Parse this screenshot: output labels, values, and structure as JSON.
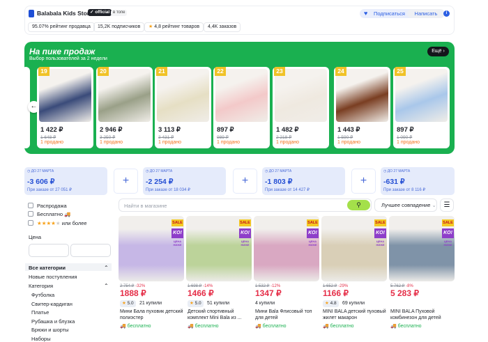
{
  "store": {
    "name": "Balabala Kids Store",
    "official_badge": "official",
    "top_badge": "в топе",
    "rating_seller": "95.07% рейтинг продавца",
    "subscribers": "15,2K подписчиков",
    "rating_goods": "4,8 рейтинг товаров",
    "orders": "4,4K заказов",
    "subscribe_label": "Подписаться",
    "write_label": "Написать"
  },
  "banner": {
    "title": "На пике продаж",
    "subtitle": "Выбор пользователей за 2 недели",
    "more_label": "Ещё",
    "items": [
      {
        "rank": "19",
        "price": "1 422 ₽",
        "old": "1 648 ₽",
        "sold": "1 продано",
        "color": "#3a4b7a"
      },
      {
        "rank": "20",
        "price": "2 946 ₽",
        "old": "3 250 ₽",
        "sold": "1 продано",
        "color": "#9aa088"
      },
      {
        "rank": "21",
        "price": "3 113 ₽",
        "old": "3 431 ₽",
        "sold": "1 продано",
        "color": "#e6dfc4"
      },
      {
        "rank": "22",
        "price": "897 ₽",
        "old": "989 ₽",
        "sold": "1 продано",
        "color": "#f3c9c9"
      },
      {
        "rank": "23",
        "price": "1 482 ₽",
        "old": "2 218 ₽",
        "sold": "1 продано",
        "color": "#efe9e0"
      },
      {
        "rank": "24",
        "price": "1 443 ₽",
        "old": "1 590 ₽",
        "sold": "1 продано",
        "color": "#7a3e22"
      },
      {
        "rank": "25",
        "price": "897 ₽",
        "old": "1 090 ₽",
        "sold": "1 продано",
        "color": "#a9c7ea"
      }
    ]
  },
  "coupons": [
    {
      "date": "ДО 27 МАРТА",
      "amount": "-3 606 ₽",
      "cond": "При заказе от 27 051 ₽"
    },
    {
      "date": "ДО 27 МАРТА",
      "amount": "-2 254 ₽",
      "cond": "При заказе от 18 034 ₽"
    },
    {
      "date": "ДО 27 МАРТА",
      "amount": "-1 803 ₽",
      "cond": "При заказе от 14 427 ₽"
    },
    {
      "date": "ДО 27 МАРТА",
      "amount": "-631 ₽",
      "cond": "При заказе от 8 116 ₽"
    }
  ],
  "filters": {
    "sale": "Распродажа",
    "free": "Бесплатно",
    "rating_suffix": "или более",
    "price_label": "Цена",
    "all_categories": "Все категории",
    "new_arrivals": "Новые поступления",
    "category": "Категория",
    "subcategories": [
      "Футболка",
      "Свитер-кардиган",
      "Платье",
      "Рубашка и блузка",
      "Брюки и шорты",
      "Наборы"
    ]
  },
  "search": {
    "placeholder": "Найти в магазине",
    "sort_label": "Лучшее совпадение"
  },
  "products": [
    {
      "old": "2 754 ₽",
      "disc": "-32%",
      "price": "1888 ₽",
      "rating": "5.0",
      "bought": "21 купили",
      "name": "Мини Бала пуховик детский полиэстер",
      "free": "бесплатно",
      "color": "#c6b7e6"
    },
    {
      "old": "1 698 ₽",
      "disc": "-14%",
      "price": "1466 ₽",
      "rating": "5.0",
      "bought": "51 купили",
      "name": "Детский спортивный комплект Mini Bala из ...",
      "free": "бесплатно",
      "color": "#bcd39a"
    },
    {
      "old": "1 532 ₽",
      "disc": "-12%",
      "price": "1347 ₽",
      "rating": "",
      "bought": "4 купили",
      "name": "Мини Bala Флисовый топ для детей",
      "free": "бесплатно",
      "color": "#d9a8c2"
    },
    {
      "old": "1 652 ₽",
      "disc": "-29%",
      "price": "1166 ₽",
      "rating": "4.8",
      "bought": "69 купили",
      "name": "MINI BALA детский пуховый жилет макарон",
      "free": "бесплатно",
      "color": "#d9cfb7"
    },
    {
      "old": "5 762 ₽",
      "disc": "-8%",
      "price": "5 283 ₽",
      "rating": "",
      "bought": "",
      "name": "MINI BALA Пуховой комбинезон для детей",
      "free": "бесплатно",
      "color": "#7f93a8"
    }
  ],
  "badges": {
    "sale": "SALE",
    "ko": "KO!",
    "cena": "ЦЕНА НИЖЕ"
  }
}
